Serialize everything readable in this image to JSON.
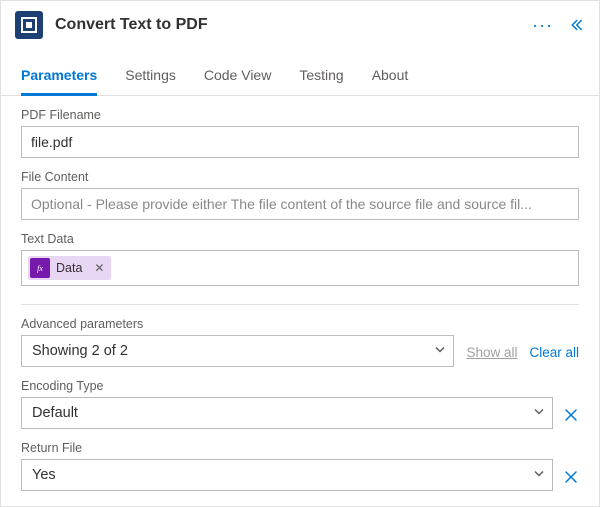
{
  "header": {
    "title": "Convert Text to PDF"
  },
  "tabs": {
    "parameters": "Parameters",
    "settings": "Settings",
    "codeview": "Code View",
    "testing": "Testing",
    "about": "About"
  },
  "fields": {
    "pdf_filename": {
      "label": "PDF Filename",
      "value": "file.pdf"
    },
    "file_content": {
      "label": "File Content",
      "placeholder": "Optional - Please provide either The file content of the source file and source fil..."
    },
    "text_data": {
      "label": "Text Data",
      "token_label": "Data"
    }
  },
  "advanced": {
    "label": "Advanced parameters",
    "summary": "Showing 2 of 2",
    "show_all": "Show all",
    "clear_all": "Clear all",
    "encoding": {
      "label": "Encoding Type",
      "value": "Default"
    },
    "returnfile": {
      "label": "Return File",
      "value": "Yes"
    }
  }
}
